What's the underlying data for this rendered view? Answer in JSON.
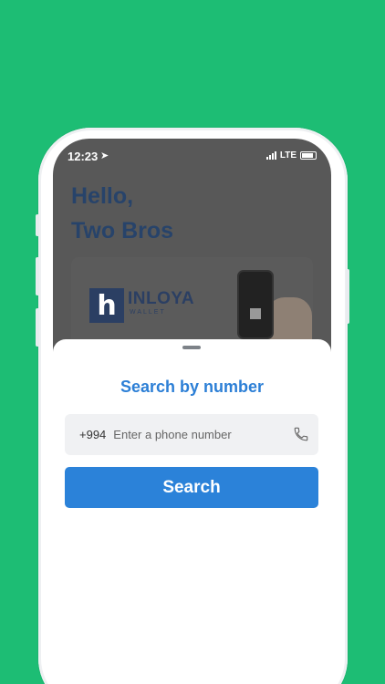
{
  "status_bar": {
    "time": "12:23",
    "network": "LTE",
    "location_icon": "location-arrow-icon"
  },
  "greeting": {
    "line1": "Hello,",
    "line2": "Two Bros"
  },
  "promo_card": {
    "brand_name": "INLOYA",
    "brand_sub": "WALLET",
    "logo_letter": "h"
  },
  "search_sheet": {
    "title": "Search by number",
    "country_code": "+994",
    "phone_placeholder": "Enter a phone number",
    "phone_value": "",
    "search_button_label": "Search",
    "phone_icon": "phone-icon"
  },
  "colors": {
    "background": "#1dbd74",
    "accent": "#2b82d9",
    "title": "#2c7fd6",
    "greeting": "#27436a"
  }
}
